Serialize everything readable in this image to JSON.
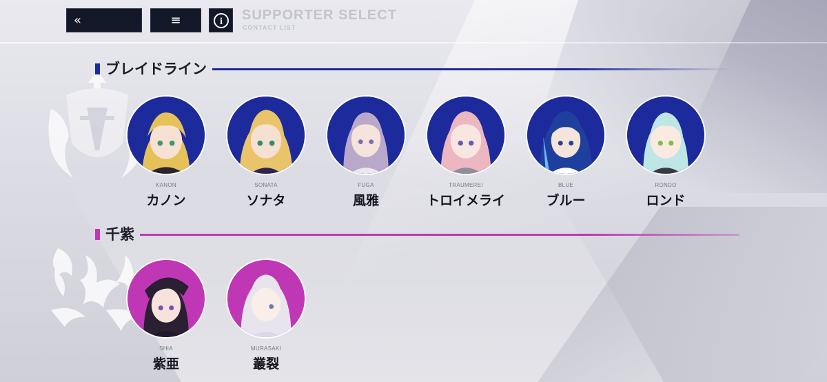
{
  "header": {
    "back_icon": "«",
    "menu_icon": "≡",
    "info_icon": "i",
    "title": "SUPPORTER SELECT",
    "subtitle": "CONTACT LIST"
  },
  "colors": {
    "bladeline": "#1c2a9c",
    "chishi": "#c037b6",
    "button_bg": "#131828"
  },
  "groups": [
    {
      "title": "ブレイドライン",
      "members": [
        {
          "romaji": "KANON",
          "name": "カノン",
          "hair": "#e6c15a"
        },
        {
          "romaji": "SONATA",
          "name": "ソナタ",
          "hair": "#e9c46a"
        },
        {
          "romaji": "FUGA",
          "name": "風雅",
          "hair": "#b9a8c9"
        },
        {
          "romaji": "TRAUMEREI",
          "name": "トロイメライ",
          "hair": "#ecb7c0"
        },
        {
          "romaji": "BLUE",
          "name": "ブルー",
          "hair": "#1f3f9e"
        },
        {
          "romaji": "RONDO",
          "name": "ロンド",
          "hair": "#bfe6e6"
        }
      ]
    },
    {
      "title": "千紫",
      "members": [
        {
          "romaji": "SHIA",
          "name": "紫亜",
          "hair": "#2a1f33"
        },
        {
          "romaji": "MURASAKI",
          "name": "叢裂",
          "hair": "#e7e4ee"
        }
      ]
    }
  ]
}
